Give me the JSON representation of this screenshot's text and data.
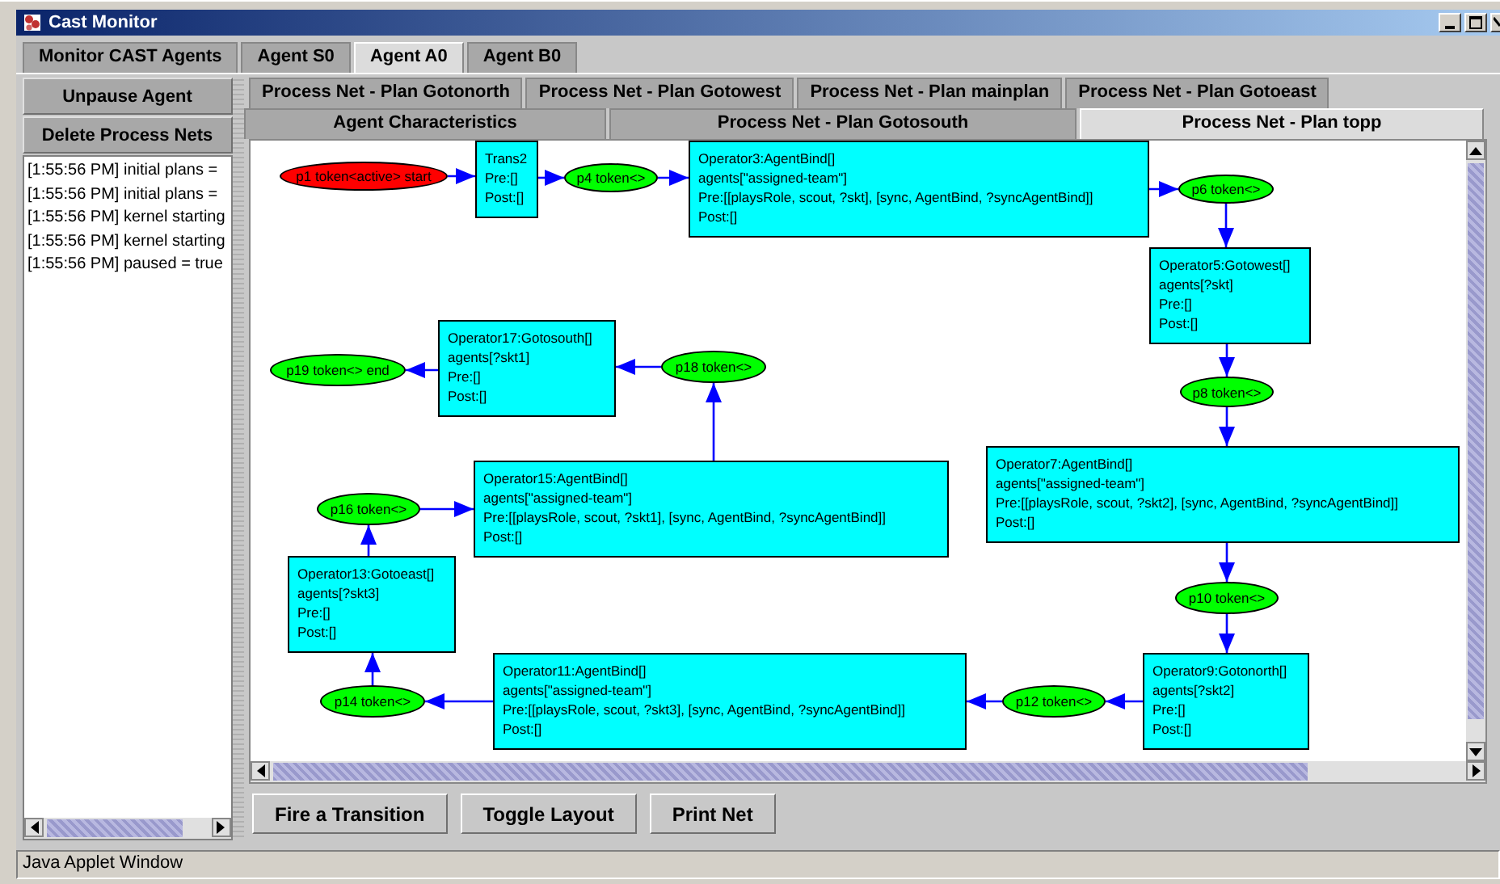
{
  "window": {
    "title": "Cast Monitor"
  },
  "agent_tabs": [
    {
      "label": "Monitor CAST Agents",
      "selected": false
    },
    {
      "label": "Agent S0",
      "selected": false
    },
    {
      "label": "Agent A0",
      "selected": true
    },
    {
      "label": "Agent B0",
      "selected": false
    }
  ],
  "agent_buttons": [
    "Unpause Agent",
    "Delete Process Nets"
  ],
  "log": [
    "[1:55:56 PM] initial plans =",
    "[1:55:56 PM] initial plans =",
    "[1:55:56 PM] kernel starting",
    "[1:55:56 PM] kernel starting",
    "[1:55:56 PM] paused = true"
  ],
  "plan_tab_rows": [
    {
      "tabs": [
        {
          "label": "Process Net - Plan Gotonorth",
          "selected": false
        },
        {
          "label": "Process Net - Plan Gotowest",
          "selected": false
        },
        {
          "label": "Process Net - Plan mainplan",
          "selected": false
        },
        {
          "label": "Process Net - Plan Gotoeast",
          "selected": false
        }
      ]
    },
    {
      "tabs": [
        {
          "label": "Agent Characteristics",
          "selected": false
        },
        {
          "label": "Process Net - Plan Gotosouth",
          "selected": false
        },
        {
          "label": "Process Net - Plan topp",
          "selected": true
        }
      ]
    }
  ],
  "net": [
    {
      "kind": "place",
      "label": "p1 token<active> start",
      "color": "#ff0000"
    },
    {
      "kind": "transition",
      "lines": [
        "Trans2",
        "Pre:[]",
        "Post:[]"
      ]
    },
    {
      "kind": "place",
      "label": "p4 token<>",
      "color": "#00ff00"
    },
    {
      "kind": "transition",
      "lines": [
        "Operator3:AgentBind[]",
        "agents[\"assigned-team\"]",
        "Pre:[[playsRole, scout, ?skt], [sync, AgentBind, ?syncAgentBind]]",
        "Post:[]"
      ]
    },
    {
      "kind": "place",
      "label": "p6 token<>",
      "color": "#00ff00"
    },
    {
      "kind": "transition",
      "lines": [
        "Operator5:Gotowest[]",
        "agents[?skt]",
        "Pre:[]",
        "Post:[]"
      ]
    },
    {
      "kind": "place",
      "label": "p19 token<> end",
      "color": "#00ff00"
    },
    {
      "kind": "transition",
      "lines": [
        "Operator17:Gotosouth[]",
        "agents[?skt1]",
        "Pre:[]",
        "Post:[]"
      ]
    },
    {
      "kind": "place",
      "label": "p18 token<>",
      "color": "#00ff00"
    },
    {
      "kind": "place",
      "label": "p8 token<>",
      "color": "#00ff00"
    },
    {
      "kind": "place",
      "label": "p16 token<>",
      "color": "#00ff00"
    },
    {
      "kind": "transition",
      "lines": [
        "Operator15:AgentBind[]",
        "agents[\"assigned-team\"]",
        "Pre:[[playsRole, scout, ?skt1], [sync, AgentBind, ?syncAgentBind]]",
        "Post:[]"
      ]
    },
    {
      "kind": "transition",
      "lines": [
        "Operator7:AgentBind[]",
        "agents[\"assigned-team\"]",
        "Pre:[[playsRole, scout, ?skt2], [sync, AgentBind, ?syncAgentBind]]",
        "Post:[]"
      ]
    },
    {
      "kind": "transition",
      "lines": [
        "Operator13:Gotoeast[]",
        "agents[?skt3]",
        "Pre:[]",
        "Post:[]"
      ]
    },
    {
      "kind": "place",
      "label": "p10 token<>",
      "color": "#00ff00"
    },
    {
      "kind": "place",
      "label": "p14 token<>",
      "color": "#00ff00"
    },
    {
      "kind": "transition",
      "lines": [
        "Operator11:AgentBind[]",
        "agents[\"assigned-team\"]",
        "Pre:[[playsRole, scout, ?skt3], [sync, AgentBind, ?syncAgentBind]]",
        "Post:[]"
      ]
    },
    {
      "kind": "place",
      "label": "p12 token<>",
      "color": "#00ff00"
    },
    {
      "kind": "transition",
      "lines": [
        "Operator9:Gotonorth[]",
        "agents[?skt2]",
        "Pre:[]",
        "Post:[]"
      ]
    }
  ],
  "net_buttons": [
    "Fire a Transition",
    "Toggle Layout",
    "Print Net"
  ],
  "status_bar": "Java Applet Window"
}
